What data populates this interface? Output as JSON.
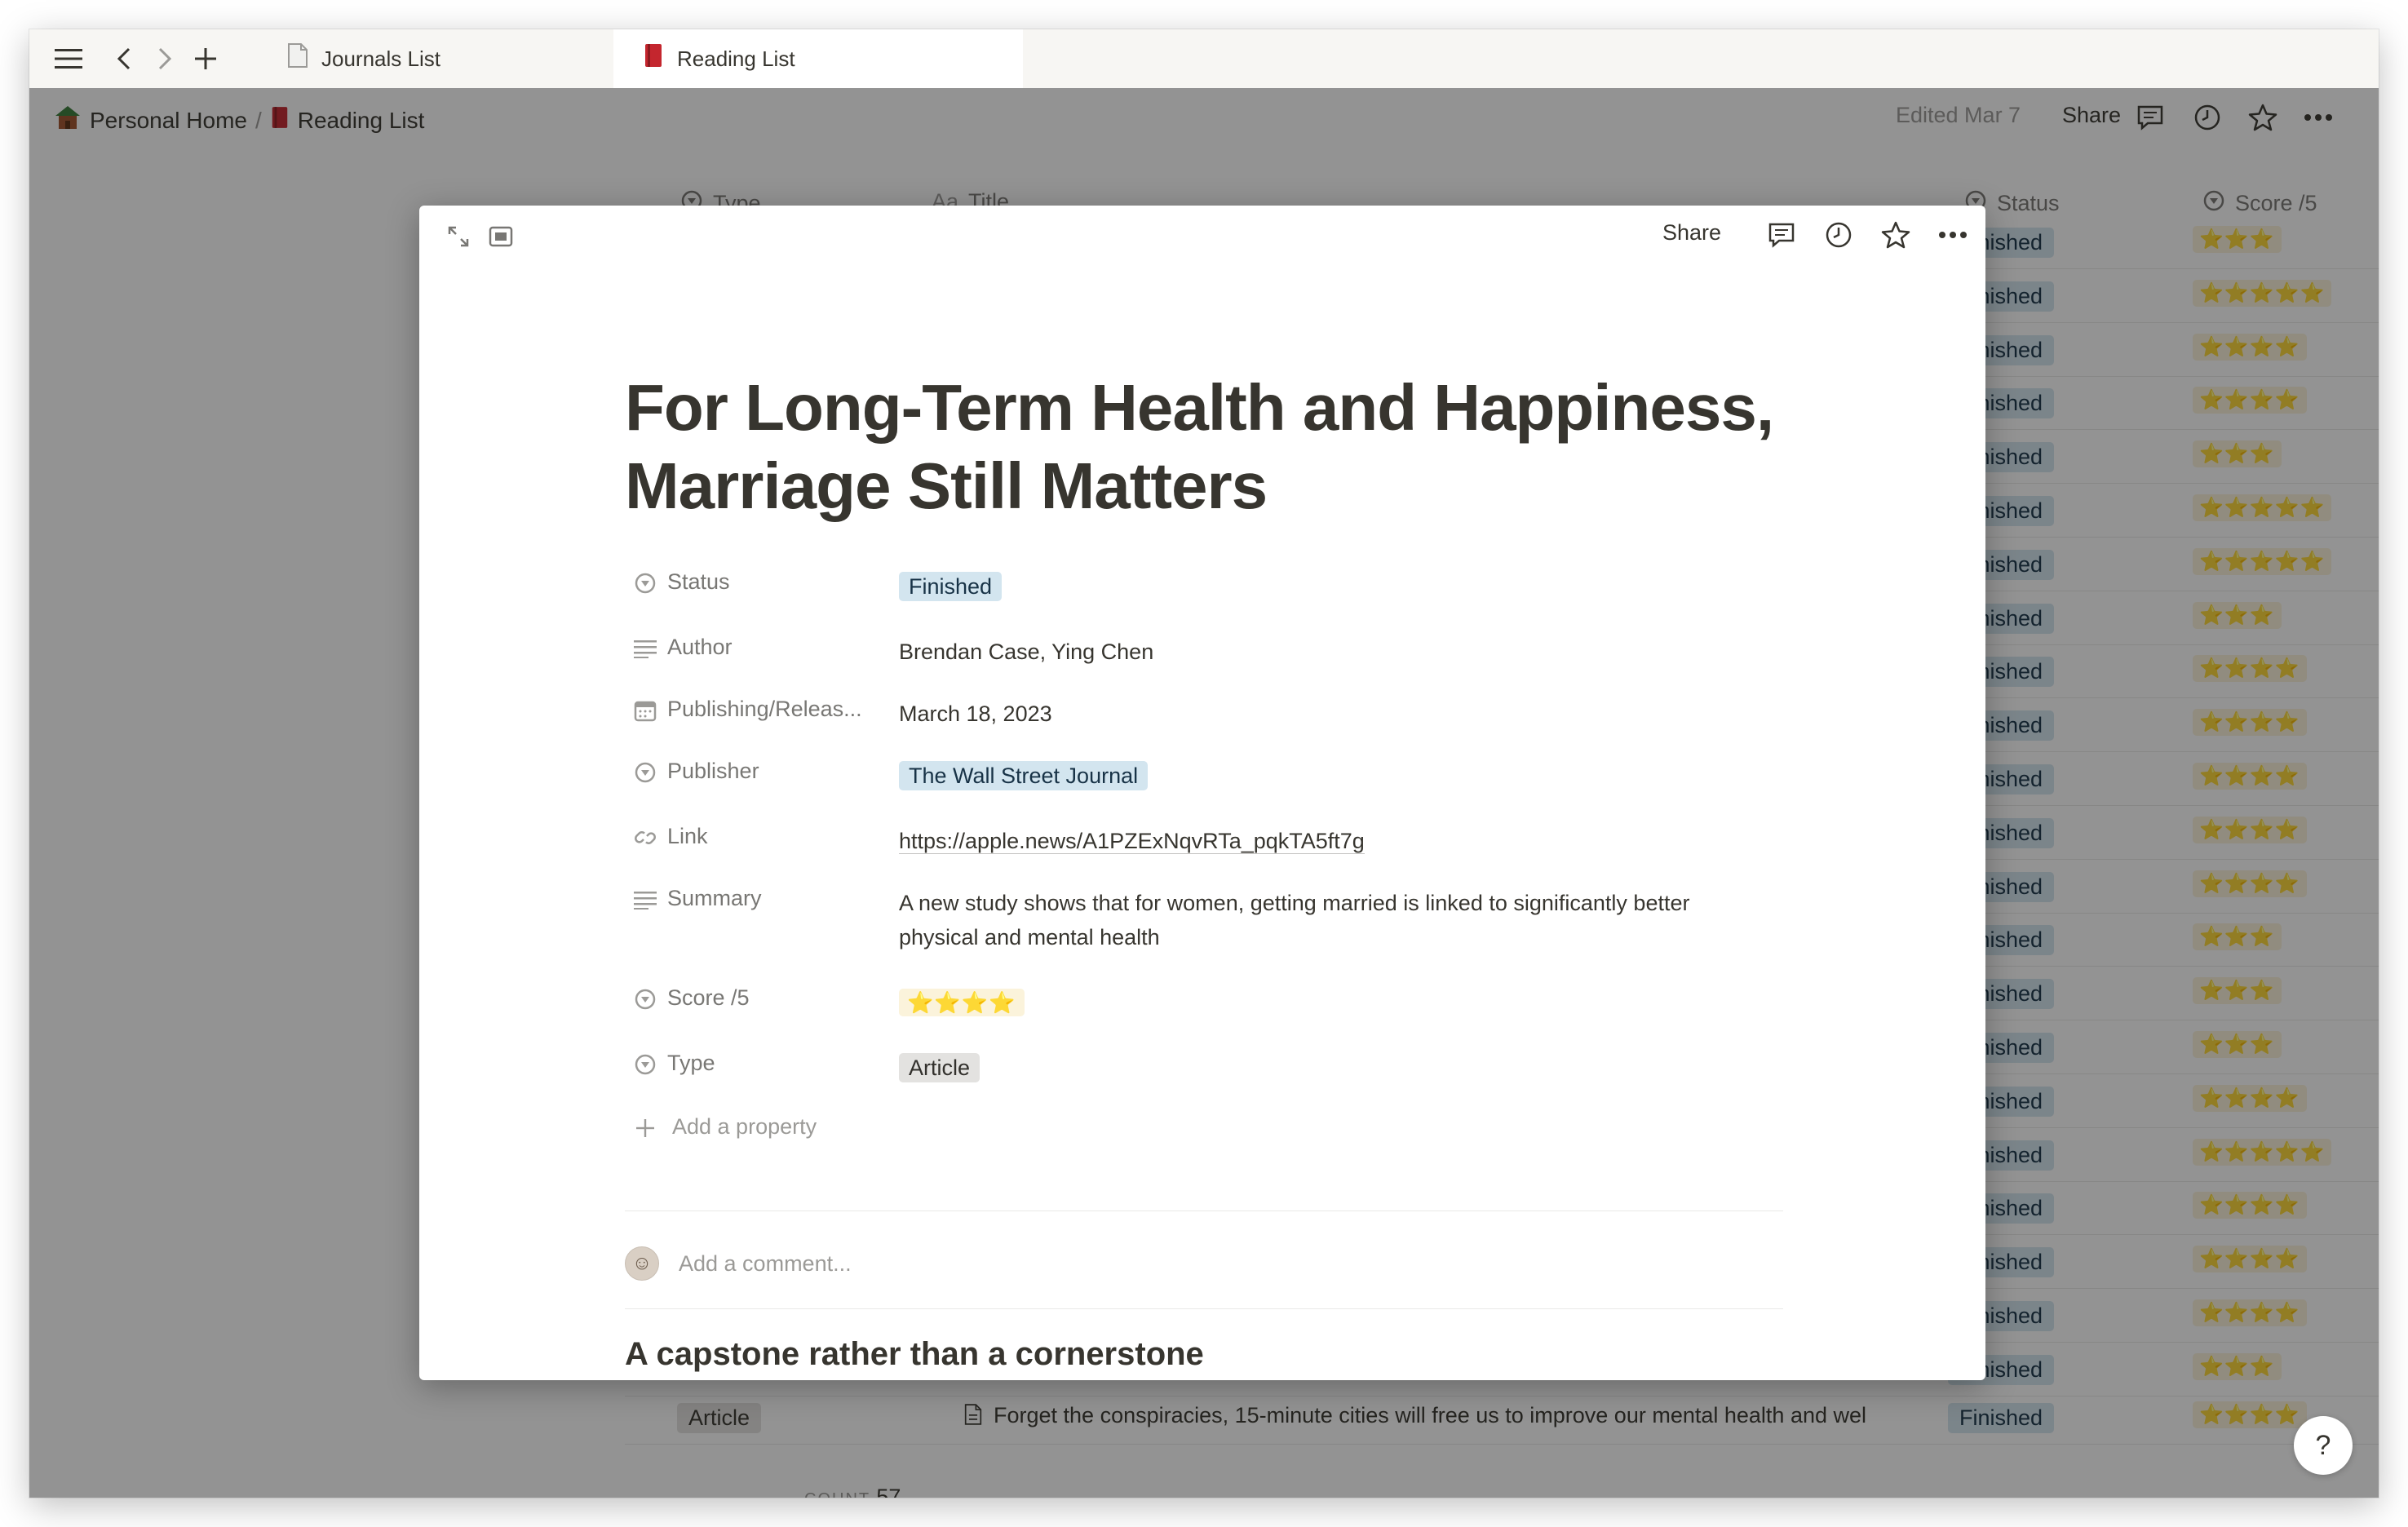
{
  "tabs": [
    {
      "label": "Journals List",
      "icon": "document-icon",
      "active": false
    },
    {
      "label": "Reading List",
      "icon": "red-book-icon",
      "active": true
    }
  ],
  "breadcrumb": {
    "home": "Personal Home",
    "separator": "/",
    "current": "Reading List"
  },
  "topbar": {
    "edited": "Edited Mar 7",
    "share": "Share"
  },
  "table": {
    "headers": {
      "type": "Type",
      "title": "Title",
      "status": "Status",
      "score": "Score /5"
    },
    "title_prefix": "Aa",
    "rows": [
      {
        "status": "Finished",
        "score": "⭐⭐⭐"
      },
      {
        "status": "Finished",
        "score": "⭐⭐⭐⭐⭐"
      },
      {
        "status": "Finished",
        "score": "⭐⭐⭐⭐"
      },
      {
        "status": "Finished",
        "score": "⭐⭐⭐⭐"
      },
      {
        "status": "Finished",
        "score": "⭐⭐⭐"
      },
      {
        "status": "Finished",
        "score": "⭐⭐⭐⭐⭐"
      },
      {
        "status": "Finished",
        "score": "⭐⭐⭐⭐⭐"
      },
      {
        "status": "Finished",
        "score": "⭐⭐⭐"
      },
      {
        "status": "Finished",
        "score": "⭐⭐⭐⭐"
      },
      {
        "status": "Finished",
        "score": "⭐⭐⭐⭐"
      },
      {
        "status": "Finished",
        "score": "⭐⭐⭐⭐"
      },
      {
        "status": "Finished",
        "score": "⭐⭐⭐⭐"
      },
      {
        "status": "Finished",
        "score": "⭐⭐⭐⭐"
      },
      {
        "status": "Finished",
        "score": "⭐⭐⭐"
      },
      {
        "status": "Finished",
        "score": "⭐⭐⭐"
      },
      {
        "status": "Finished",
        "score": "⭐⭐⭐"
      },
      {
        "status": "Finished",
        "score": "⭐⭐⭐⭐"
      },
      {
        "status": "Finished",
        "score": "⭐⭐⭐⭐⭐"
      },
      {
        "status": "Finished",
        "score": "⭐⭐⭐⭐"
      },
      {
        "status": "Finished",
        "score": "⭐⭐⭐⭐"
      },
      {
        "status": "Finished",
        "score": "⭐⭐⭐⭐"
      },
      {
        "status": "Finished",
        "score": "⭐⭐⭐"
      }
    ],
    "last_row": {
      "type": "Article",
      "title": "Forget the conspiracies, 15-minute cities will free us to improve our mental health and wel",
      "status": "Finished",
      "score": "⭐⭐⭐⭐"
    },
    "count_label": "COUNT",
    "count_value": "57"
  },
  "help_label": "?",
  "modal": {
    "share": "Share",
    "title": "For Long-Term Health and Happiness, Marriage Still Matters",
    "properties": [
      {
        "label": "Status",
        "value": "Finished",
        "kind": "pill-blue",
        "icon": "select-icon"
      },
      {
        "label": "Author",
        "value": "Brendan Case, Ying Chen",
        "kind": "text",
        "icon": "text-lines-icon"
      },
      {
        "label": "Publishing/Releas...",
        "value": "March 18, 2023",
        "kind": "text",
        "icon": "calendar-icon"
      },
      {
        "label": "Publisher",
        "value": "The Wall Street Journal",
        "kind": "pill-blue",
        "icon": "select-icon"
      },
      {
        "label": "Link",
        "value": "https://apple.news/A1PZExNqvRTa_pqkTA5ft7g",
        "kind": "link",
        "icon": "link-icon"
      },
      {
        "label": "Summary",
        "value": "A new study shows that for women, getting married is linked to significantly better physical and mental health",
        "kind": "text",
        "icon": "text-lines-icon"
      },
      {
        "label": "Score /5",
        "value": "⭐⭐⭐⭐",
        "kind": "pill-stars",
        "icon": "select-icon"
      },
      {
        "label": "Type",
        "value": "Article",
        "kind": "pill-gray",
        "icon": "select-icon"
      }
    ],
    "add_property": "Add a property",
    "comment_placeholder": "Add a comment...",
    "heading": "A capstone rather than a cornerstone"
  }
}
